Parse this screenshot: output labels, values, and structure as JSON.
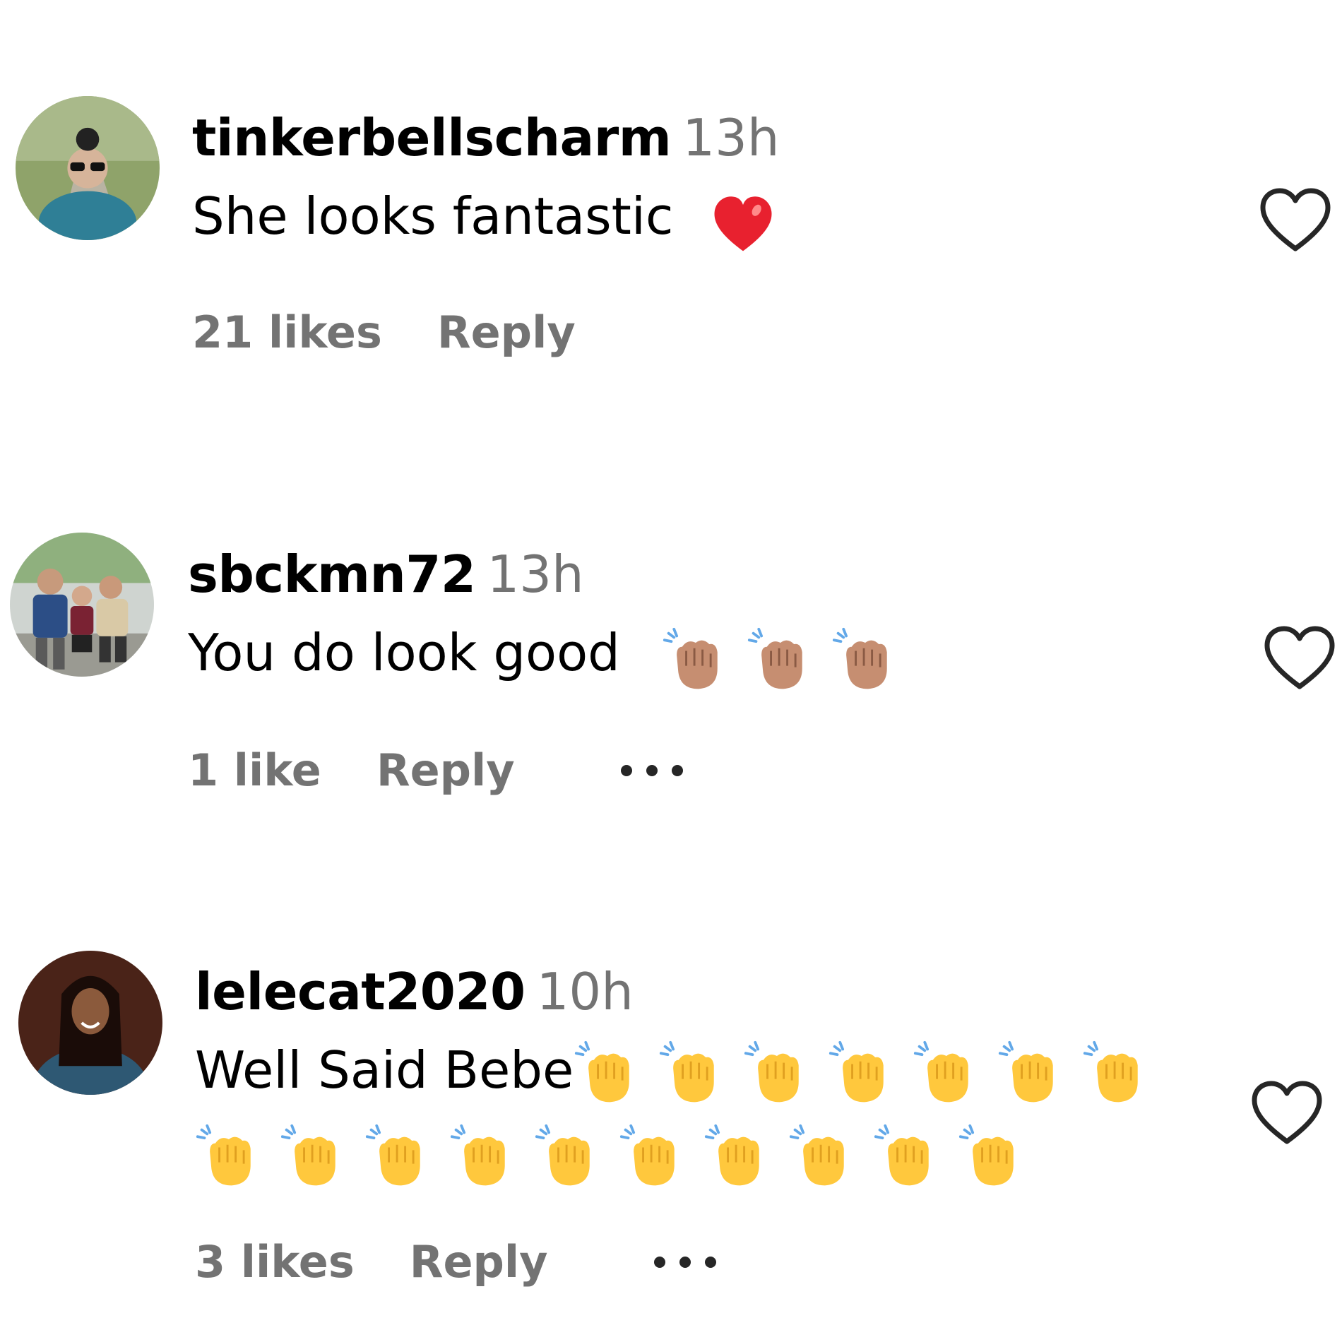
{
  "comments": [
    {
      "username": "tinkerbellscharm",
      "time": "13h",
      "text": "She looks fantastic",
      "emoji": [
        "red-heart"
      ],
      "likes": "21 likes",
      "reply": "Reply",
      "has_more": false
    },
    {
      "username": "sbckmn72",
      "time": "13h",
      "text": "You do look good",
      "emoji": [
        "clapping-hands-medium-skin",
        "clapping-hands-medium-skin",
        "clapping-hands-medium-skin"
      ],
      "likes": "1 like",
      "reply": "Reply",
      "has_more": true
    },
    {
      "username": "lelecat2020",
      "time": "10h",
      "text": "Well Said Bebe",
      "emoji": [
        "clapping-hands",
        "clapping-hands",
        "clapping-hands",
        "clapping-hands",
        "clapping-hands",
        "clapping-hands",
        "clapping-hands",
        "clapping-hands",
        "clapping-hands",
        "clapping-hands",
        "clapping-hands",
        "clapping-hands",
        "clapping-hands",
        "clapping-hands",
        "clapping-hands",
        "clapping-hands",
        "clapping-hands"
      ],
      "likes": "3 likes",
      "reply": "Reply",
      "has_more": true
    }
  ],
  "colors": {
    "muted_text": "#737373",
    "heart_outline": "#262626",
    "clap_yellow": "#FFC83D",
    "clap_skin": "#C68E71",
    "red_heart": "#E8212F"
  }
}
